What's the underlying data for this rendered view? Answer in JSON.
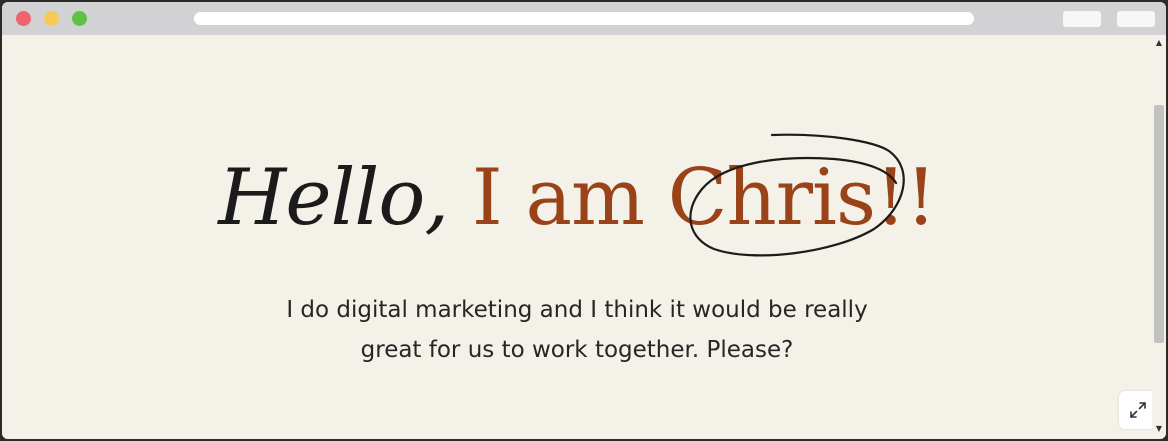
{
  "window": {
    "controls": [
      "close",
      "minimize",
      "maximize"
    ]
  },
  "hero": {
    "greeting": "Hello,",
    "intro": "I am",
    "name": "Chris",
    "exclaim": "!!",
    "subtitle_line1": "I do digital marketing and I think it would be really",
    "subtitle_line2": "great for us to work together. Please?"
  },
  "colors": {
    "accent": "#9a4318",
    "text": "#1b1b1b",
    "background": "#f4f1e9"
  },
  "icons": {
    "expand": "expand-icon",
    "scroll_up": "scroll-up-arrow",
    "scroll_down": "scroll-down-arrow"
  }
}
